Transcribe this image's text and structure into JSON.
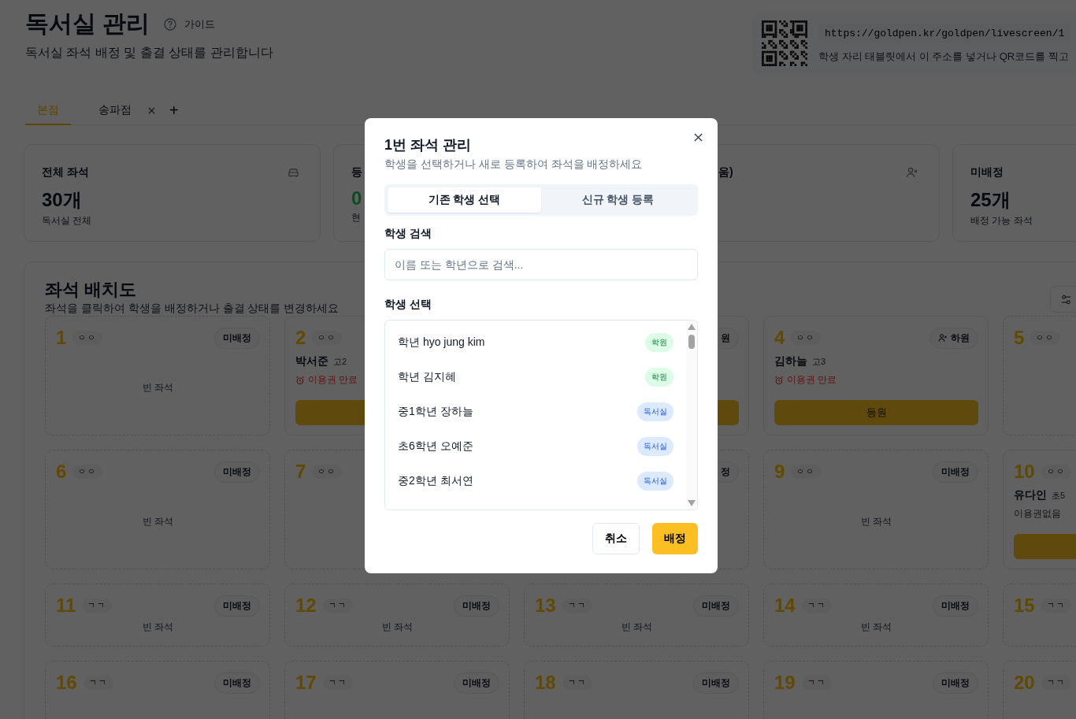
{
  "header": {
    "title": "독서실 관리",
    "guide": "가이드",
    "subtitle": "독서실 좌석 배정 및 출결 상태를 관리합니다"
  },
  "livescreen": {
    "url": "https://goldpen.kr/goldpen/livescreen/1",
    "help": "학생 자리 태블릿에서 이 주소를 넣거나 QR코드를 찍고"
  },
  "branch_tabs": [
    {
      "label": "본점",
      "selected": true,
      "closable": false
    },
    {
      "label": "송파점",
      "selected": false,
      "closable": true
    }
  ],
  "add_tab": "+",
  "stats": [
    {
      "kind": "total",
      "title": "전체 좌석",
      "value": "30개",
      "caption": "독서실 전체"
    },
    {
      "kind": "present",
      "title": "등",
      "value": "0",
      "caption": "현"
    },
    {
      "kind": "absent",
      "title": "움)"
    },
    {
      "kind": "unassigned",
      "title": "미배정",
      "value": "25개",
      "caption": "배정 가능 좌석"
    }
  ],
  "seat_map": {
    "title": "좌석 배치도",
    "subtitle": "좌석을 클릭하여 학생을 배정하거나 출결 상태를 변경하세요",
    "seats": [
      {
        "kind": "empty",
        "number": "1",
        "tag": "ㅇㅇ",
        "status": "미배정",
        "empty_label": "빈 좌석"
      },
      {
        "kind": "occupied",
        "number": "2",
        "tag": "ㅇㅇ",
        "name": "박서준",
        "grade": "고2",
        "pass": "이용권 만료",
        "expired": true,
        "button": true
      },
      {
        "kind": "occupied",
        "status": "원",
        "button": true
      },
      {
        "kind": "occupied",
        "number": "4",
        "tag": "ㅇㅇ",
        "status": "하원",
        "status_icon": true,
        "name": "김하늘",
        "grade": "고3",
        "pass": "이용권 만료",
        "expired": true,
        "button": true,
        "button_label": "등원"
      },
      {
        "kind": "empty",
        "number": "5",
        "tag": "ㅇㅇ"
      },
      {
        "kind": "empty",
        "number": "6",
        "tag": "ㅇㅇ",
        "status": "미배정",
        "empty_label": "빈 좌석"
      },
      {
        "kind": "empty",
        "number": "7",
        "tag": "ㅇㅇ"
      },
      {
        "kind": "empty",
        "status": "정"
      },
      {
        "kind": "empty",
        "number": "9",
        "tag": "ㅇㅇ",
        "status": "미배정",
        "empty_label": "빈 좌석"
      },
      {
        "kind": "occupied",
        "number": "10",
        "tag": "ㅇㅇ",
        "name": "유다인",
        "grade": "초5",
        "pass": "이용권없음",
        "expired": false,
        "button": true
      },
      {
        "kind": "empty",
        "number": "11",
        "tag": "ㄱㄱ",
        "status": "미배정",
        "empty_label": "빈 좌석"
      },
      {
        "kind": "empty",
        "number": "12",
        "tag": "ㄱㄱ",
        "status": "미배정",
        "empty_label": "빈 좌석"
      },
      {
        "kind": "empty",
        "number": "13",
        "tag": "ㄱㄱ",
        "status": "미배정",
        "empty_label": "빈 좌석"
      },
      {
        "kind": "empty",
        "number": "14",
        "tag": "ㄱㄱ",
        "status": "미배정",
        "empty_label": "빈 좌석"
      },
      {
        "kind": "empty",
        "number": "15",
        "tag": "ㄱㄱ"
      },
      {
        "kind": "empty",
        "number": "16",
        "tag": "ㄱㄱ",
        "status": "미배정"
      },
      {
        "kind": "empty",
        "number": "17",
        "tag": "ㄱㄱ",
        "status": "미배정"
      },
      {
        "kind": "empty",
        "number": "18",
        "tag": "ㄱㄱ",
        "status": "미배정"
      },
      {
        "kind": "empty",
        "number": "19",
        "tag": "ㄱㄱ",
        "status": "미배정"
      },
      {
        "kind": "empty",
        "number": "20",
        "tag": "ㄱㄱ"
      }
    ]
  },
  "dialog": {
    "title": "1번 좌석 관리",
    "subtitle": "학생을 선택하거나 새로 등록하여 좌석을 배정하세요",
    "tabs": [
      {
        "label": "기존 학생 선택",
        "selected": true
      },
      {
        "label": "신규 학생 등록",
        "selected": false
      }
    ],
    "search_label": "학생 검색",
    "search": {
      "placeholder": "이름 또는 학년으로 검색..."
    },
    "list_label": "학생 선택",
    "students": [
      {
        "name": "학년 hyo jung kim",
        "type": "학원",
        "kind": "academy"
      },
      {
        "name": "학년 김지혜",
        "type": "학원",
        "kind": "academy"
      },
      {
        "name": "중1학년 장하늘",
        "type": "독서실",
        "kind": "reading_room"
      },
      {
        "name": "초6학년 오예준",
        "type": "독서실",
        "kind": "reading_room"
      },
      {
        "name": "중2학년 최서연",
        "type": "독서실",
        "kind": "reading_room"
      }
    ],
    "cancel": "취소",
    "confirm": "배정"
  }
}
